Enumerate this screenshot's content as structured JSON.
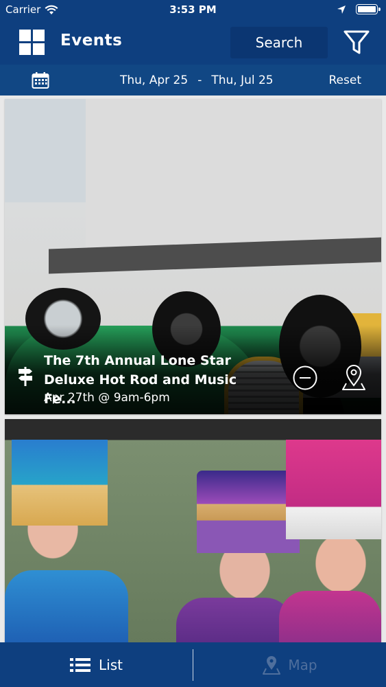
{
  "status_bar": {
    "carrier": "Carrier",
    "time": "3:53 PM",
    "icons": [
      "wifi-icon",
      "location-arrow-icon",
      "battery-icon"
    ]
  },
  "header": {
    "title": "Events",
    "search_label": "Search",
    "menu_icon": "grid-icon",
    "filter_icon": "filter-icon"
  },
  "date_bar": {
    "calendar_icon": "calendar-icon",
    "start_date": "Thu, Apr 25",
    "separator": "-",
    "end_date": "Thu, Jul 25",
    "reset_label": "Reset"
  },
  "events": [
    {
      "title": "The 7th Annual Lone Star\nDeluxe Hot Rod and Music Fe...",
      "date": "Apr 27th @ 9am-6pm",
      "icons": [
        "signpost-icon",
        "remove-circle-icon",
        "map-pin-icon"
      ]
    }
  ],
  "tabs": {
    "list_label": "List",
    "map_label": "Map",
    "active": "List"
  },
  "colors": {
    "header_bg": "#0e3f7f",
    "date_bar_bg": "#114784",
    "active_tab_text": "#ffffff",
    "inactive_tab_text": "#4f6f9d"
  }
}
